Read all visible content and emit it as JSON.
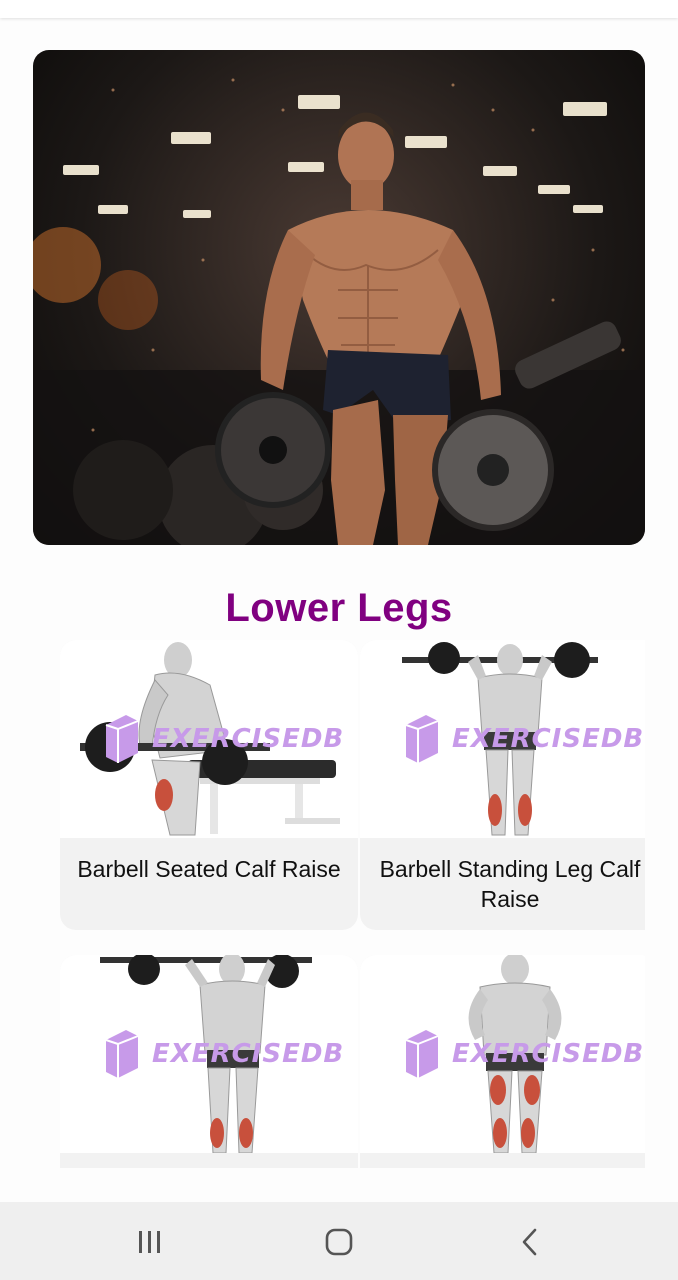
{
  "section_title": "Lower Legs",
  "watermark_text": "EXERCISEDB",
  "exercises": [
    {
      "name": "Barbell Seated Calf Raise"
    },
    {
      "name": "Barbell Standing Leg Calf Raise"
    },
    {
      "name": ""
    },
    {
      "name": ""
    }
  ],
  "nav": {
    "recent_icon": "recent-apps-icon",
    "home_icon": "home-icon",
    "back_icon": "back-icon"
  },
  "colors": {
    "title": "#800080",
    "watermark": "#c79ae9",
    "card_bg": "#f2f2f2",
    "navbar_bg": "#efefef"
  }
}
